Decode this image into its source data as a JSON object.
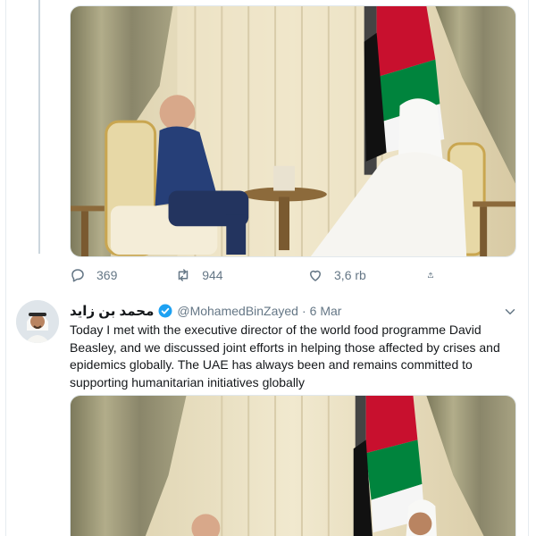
{
  "thread": {
    "stats": {
      "replies": "369",
      "retweets": "944",
      "likes": "3,6 rb"
    }
  },
  "tweet": {
    "display_name": "محمد بن زايد",
    "handle": "@MohamedBinZayed",
    "separator": "·",
    "date": "6 Mar",
    "text": "Today I met with the executive director of the world food programme David Beasley, and we discussed joint efforts in helping those affected by crises and epidemics globally. The UAE has always been and remains committed to supporting humanitarian initiatives globally"
  },
  "icons": {
    "reply": "reply-icon",
    "retweet": "retweet-icon",
    "like": "heart-icon",
    "share": "share-icon",
    "verified": "verified-badge-icon",
    "more": "chevron-down-icon"
  },
  "colors": {
    "text": "#14171a",
    "muted": "#657786",
    "verified": "#1da1f2",
    "border": "#e6ecf0"
  }
}
